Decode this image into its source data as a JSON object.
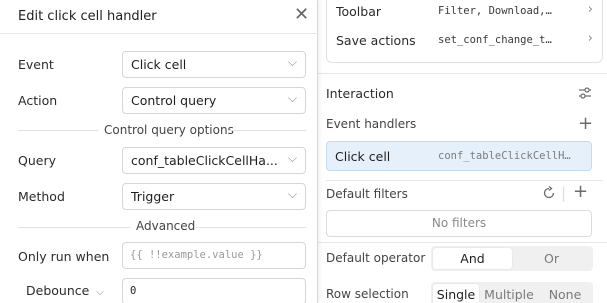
{
  "modal": {
    "title": "Edit click cell handler",
    "close_icon": "close-icon",
    "event": {
      "label": "Event",
      "value": "Click cell"
    },
    "action": {
      "label": "Action",
      "value": "Control query"
    },
    "control_query_options_label": "Control query options",
    "query": {
      "label": "Query",
      "value": "conf_tableClickCellHa..."
    },
    "method": {
      "label": "Method",
      "value": "Trigger"
    },
    "advanced_label": "Advanced",
    "only_run_when": {
      "label": "Only run when",
      "placeholder": "{{ !!example.value }}"
    },
    "debounce": {
      "label": "Debounce",
      "value": "0"
    }
  },
  "inspector": {
    "toolbar": {
      "label": "Toolbar",
      "value": "Filter, Download,…"
    },
    "save_actions": {
      "label": "Save actions",
      "value": "set_conf_change_t…"
    },
    "interaction_title": "Interaction",
    "event_handlers_title": "Event handlers",
    "event_handler": {
      "label": "Click cell",
      "value": "conf_tableClickCellH…"
    },
    "default_filters_title": "Default filters",
    "no_filters": "No filters",
    "default_operator": {
      "label": "Default operator",
      "options": [
        "And",
        "Or"
      ],
      "selected": "And"
    },
    "row_selection": {
      "label": "Row selection",
      "options": [
        "Single",
        "Multiple",
        "None"
      ],
      "selected": "Single"
    }
  },
  "colors": {
    "accent_bg": "#e6f0fb",
    "accent_border": "#c5dbf3"
  }
}
